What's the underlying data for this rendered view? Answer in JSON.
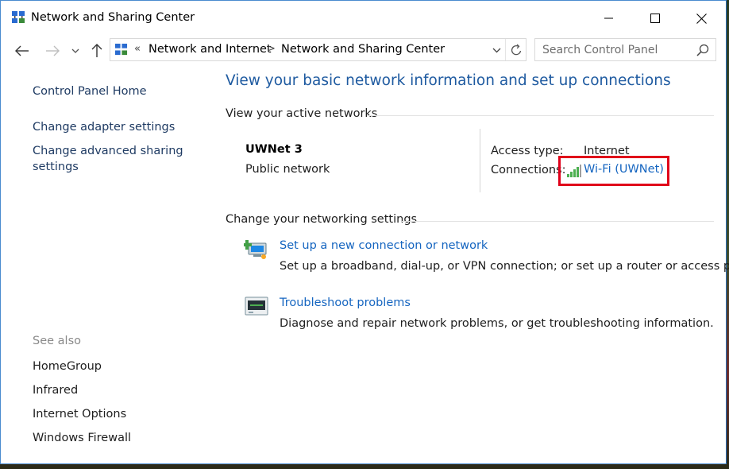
{
  "window": {
    "title": "Network and Sharing Center",
    "controls": {
      "minimize": "minimize",
      "maximize": "maximize",
      "close": "close"
    }
  },
  "navigation": {
    "back_icon": "arrow-left-icon",
    "forward_icon": "arrow-right-icon",
    "recent_icon": "chevron-down-icon",
    "up_icon": "arrow-up-icon"
  },
  "address_bar": {
    "overflow": "«",
    "separator": ">",
    "segments": [
      "Network and Internet",
      "Network and Sharing Center"
    ],
    "refresh_icon": "refresh-icon"
  },
  "search": {
    "placeholder": "Search Control Panel",
    "icon": "search-icon"
  },
  "sidebar": {
    "home": "Control Panel Home",
    "links": [
      "Change adapter settings",
      "Change advanced sharing settings"
    ],
    "see_also_heading": "See also",
    "see_also": [
      "HomeGroup",
      "Infrared",
      "Internet Options",
      "Windows Firewall"
    ]
  },
  "main": {
    "title": "View your basic network information and set up connections",
    "active_networks": {
      "heading": "View your active networks",
      "network_name": "UWNet  3",
      "network_type": "Public network",
      "access_type_label": "Access type:",
      "access_type_value": "Internet",
      "connections_label": "Connections:",
      "connection_link": "Wi-Fi (UWNet)",
      "connection_icon": "wifi-signal-icon"
    },
    "change_settings": {
      "heading": "Change your networking settings",
      "tasks": [
        {
          "link": "Set up a new connection or network",
          "description": "Set up a broadband, dial-up, or VPN connection; or set up a router or access point.",
          "icon": "new-connection-icon"
        },
        {
          "link": "Troubleshoot problems",
          "description": "Diagnose and repair network problems, or get troubleshooting information.",
          "icon": "troubleshoot-icon"
        }
      ]
    }
  },
  "colors": {
    "link": "#1565c0",
    "title": "#1e5aa0",
    "highlight_border": "#e0001a",
    "window_border": "#4a8bcf"
  }
}
